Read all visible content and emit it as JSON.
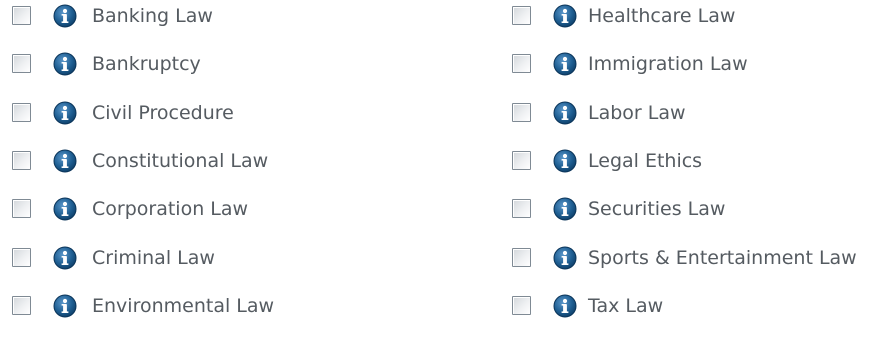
{
  "practice_areas": {
    "left": [
      {
        "label": "Banking Law"
      },
      {
        "label": "Bankruptcy"
      },
      {
        "label": "Civil Procedure"
      },
      {
        "label": "Constitutional Law"
      },
      {
        "label": "Corporation Law"
      },
      {
        "label": "Criminal Law"
      },
      {
        "label": "Environmental Law"
      }
    ],
    "right": [
      {
        "label": "Healthcare Law"
      },
      {
        "label": "Immigration Law"
      },
      {
        "label": "Labor Law"
      },
      {
        "label": "Legal Ethics"
      },
      {
        "label": "Securities Law"
      },
      {
        "label": "Sports & Entertainment Law"
      },
      {
        "label": "Tax Law"
      }
    ]
  },
  "icons": {
    "info": "info-icon"
  },
  "colors": {
    "label_text": "#555b61",
    "info_icon_fill": "#1f5f93",
    "checkbox_border": "#7f8a94"
  }
}
